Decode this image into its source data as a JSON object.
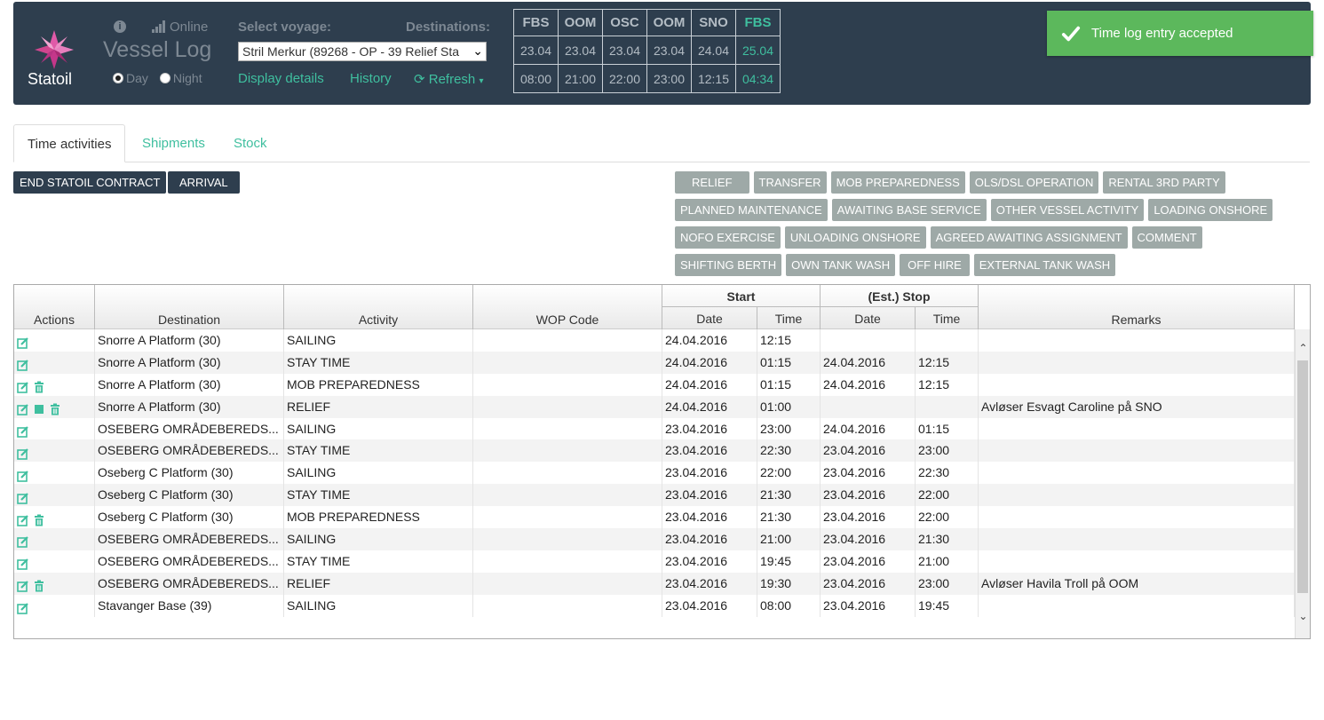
{
  "header": {
    "logo_text": "Statoil",
    "online_label": "Online",
    "app_title": "Vessel Log",
    "shift": {
      "day_label": "Day",
      "night_label": "Night",
      "selected": "Day"
    },
    "voyage_label": "Select voyage:",
    "voyage_value": "Stril Merkur (89268 - OP - 39 Relief Sta",
    "destinations_label": "Destinations:",
    "links": {
      "display_details": "Display details",
      "history": "History",
      "refresh": "Refresh"
    }
  },
  "destinations": [
    {
      "code": "FBS",
      "date": "23.04",
      "time": "08:00",
      "highlight": false
    },
    {
      "code": "OOM",
      "date": "23.04",
      "time": "21:00",
      "highlight": false
    },
    {
      "code": "OSC",
      "date": "23.04",
      "time": "22:00",
      "highlight": false
    },
    {
      "code": "OOM",
      "date": "23.04",
      "time": "23:00",
      "highlight": false
    },
    {
      "code": "SNO",
      "date": "24.04",
      "time": "12:15",
      "highlight": false
    },
    {
      "code": "FBS",
      "date": "25.04",
      "time": "04:34",
      "highlight": true
    }
  ],
  "toast": {
    "message": "Time log entry accepted"
  },
  "tabs": [
    "Time activities",
    "Shipments",
    "Stock"
  ],
  "buttons": {
    "end_contract": "END STATOIL CONTRACT",
    "arrival": "ARRIVAL"
  },
  "activity_buttons": [
    "RELIEF",
    "TRANSFER",
    "MOB PREPAREDNESS",
    "OLS/DSL OPERATION",
    "RENTAL 3RD PARTY",
    "PLANNED MAINTENANCE",
    "AWAITING BASE SERVICE",
    "OTHER VESSEL ACTIVITY",
    "LOADING ONSHORE",
    "NOFO EXERCISE",
    "UNLOADING ONSHORE",
    "AGREED AWAITING ASSIGNMENT",
    "COMMENT",
    "SHIFTING BERTH",
    "OWN TANK WASH",
    "OFF HIRE",
    "EXTERNAL TANK WASH"
  ],
  "table": {
    "headers": {
      "actions": "Actions",
      "destination": "Destination",
      "activity": "Activity",
      "wop": "WOP Code",
      "start": "Start",
      "stop": "(Est.) Stop",
      "date": "Date",
      "time": "Time",
      "remarks": "Remarks"
    },
    "rows": [
      {
        "icons": [
          "edit"
        ],
        "destination": "Snorre A Platform (30)",
        "activity": "SAILING",
        "wop": "",
        "start_date": "24.04.2016",
        "start_time": "12:15",
        "stop_date": "",
        "stop_time": "",
        "remarks": ""
      },
      {
        "icons": [
          "edit"
        ],
        "destination": "Snorre A Platform (30)",
        "activity": "STAY TIME",
        "wop": "",
        "start_date": "24.04.2016",
        "start_time": "01:15",
        "stop_date": "24.04.2016",
        "stop_time": "12:15",
        "remarks": ""
      },
      {
        "icons": [
          "edit",
          "delete"
        ],
        "destination": "Snorre A Platform (30)",
        "activity": "MOB PREPAREDNESS",
        "wop": "",
        "start_date": "24.04.2016",
        "start_time": "01:15",
        "stop_date": "24.04.2016",
        "stop_time": "12:15",
        "remarks": ""
      },
      {
        "icons": [
          "edit",
          "stop",
          "delete"
        ],
        "destination": "Snorre A Platform (30)",
        "activity": "RELIEF",
        "wop": "",
        "start_date": "24.04.2016",
        "start_time": "01:00",
        "stop_date": "",
        "stop_time": "",
        "remarks": "Avløser Esvagt Caroline på SNO"
      },
      {
        "icons": [
          "edit"
        ],
        "destination": "OSEBERG OMRÅDEBEREDS...",
        "activity": "SAILING",
        "wop": "",
        "start_date": "23.04.2016",
        "start_time": "23:00",
        "stop_date": "24.04.2016",
        "stop_time": "01:15",
        "remarks": ""
      },
      {
        "icons": [
          "edit"
        ],
        "destination": "OSEBERG OMRÅDEBEREDS...",
        "activity": "STAY TIME",
        "wop": "",
        "start_date": "23.04.2016",
        "start_time": "22:30",
        "stop_date": "23.04.2016",
        "stop_time": "23:00",
        "remarks": ""
      },
      {
        "icons": [
          "edit"
        ],
        "destination": "Oseberg C Platform (30)",
        "activity": "SAILING",
        "wop": "",
        "start_date": "23.04.2016",
        "start_time": "22:00",
        "stop_date": "23.04.2016",
        "stop_time": "22:30",
        "remarks": ""
      },
      {
        "icons": [
          "edit"
        ],
        "destination": "Oseberg C Platform (30)",
        "activity": "STAY TIME",
        "wop": "",
        "start_date": "23.04.2016",
        "start_time": "21:30",
        "stop_date": "23.04.2016",
        "stop_time": "22:00",
        "remarks": ""
      },
      {
        "icons": [
          "edit",
          "delete"
        ],
        "destination": "Oseberg C Platform (30)",
        "activity": "MOB PREPAREDNESS",
        "wop": "",
        "start_date": "23.04.2016",
        "start_time": "21:30",
        "stop_date": "23.04.2016",
        "stop_time": "22:00",
        "remarks": ""
      },
      {
        "icons": [
          "edit"
        ],
        "destination": "OSEBERG OMRÅDEBEREDS...",
        "activity": "SAILING",
        "wop": "",
        "start_date": "23.04.2016",
        "start_time": "21:00",
        "stop_date": "23.04.2016",
        "stop_time": "21:30",
        "remarks": ""
      },
      {
        "icons": [
          "edit"
        ],
        "destination": "OSEBERG OMRÅDEBEREDS...",
        "activity": "STAY TIME",
        "wop": "",
        "start_date": "23.04.2016",
        "start_time": "19:45",
        "stop_date": "23.04.2016",
        "stop_time": "21:00",
        "remarks": ""
      },
      {
        "icons": [
          "edit",
          "delete"
        ],
        "destination": "OSEBERG OMRÅDEBEREDS...",
        "activity": "RELIEF",
        "wop": "",
        "start_date": "23.04.2016",
        "start_time": "19:30",
        "stop_date": "23.04.2016",
        "stop_time": "23:00",
        "remarks": "Avløser Havila Troll på OOM"
      },
      {
        "icons": [
          "edit"
        ],
        "destination": "Stavanger Base (39)",
        "activity": "SAILING",
        "wop": "",
        "start_date": "23.04.2016",
        "start_time": "08:00",
        "stop_date": "23.04.2016",
        "stop_time": "19:45",
        "remarks": ""
      }
    ]
  },
  "colors": {
    "header_bg": "#2e3e4e",
    "accent": "#3fbf9f",
    "toast": "#5cb85c",
    "activity_button": "#9ea9a7"
  }
}
